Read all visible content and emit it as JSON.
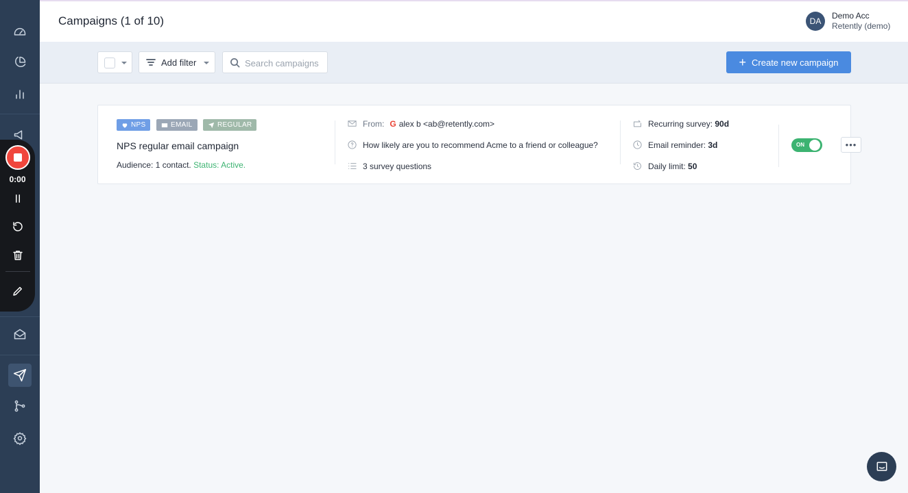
{
  "header": {
    "title": "Campaigns (1 of 10)",
    "user": {
      "initials": "DA",
      "name": "Demo Acc",
      "company": "Retently (demo)"
    }
  },
  "toolbar": {
    "add_filter_label": "Add filter",
    "search_placeholder": "Search campaigns",
    "create_label": "Create new campaign",
    "create_color": "#4a8ae0"
  },
  "recorder": {
    "time": "0:00",
    "stop_color": "#f0463c"
  },
  "sidebar": {
    "items": [
      {
        "icon": "dashboard-icon"
      },
      {
        "icon": "pie-chart-icon"
      },
      {
        "icon": "bar-chart-icon"
      },
      {
        "icon": "megaphone-icon"
      },
      {
        "icon": "inbox-icon"
      },
      {
        "icon": "send-icon",
        "active": true
      },
      {
        "icon": "git-branch-icon"
      },
      {
        "icon": "gear-icon"
      }
    ]
  },
  "campaign": {
    "tags": [
      "NPS",
      "EMAIL",
      "REGULAR"
    ],
    "name": "NPS regular email campaign",
    "audience": "Audience: 1 contact.",
    "status": "Status: Active.",
    "from_label": "From:",
    "from_value": "alex b <ab@retently.com>",
    "question": "How likely are you to recommend Acme to a friend or colleague?",
    "survey_questions": "3 survey questions",
    "recurring_label": "Recurring survey:",
    "recurring_value": "90d",
    "reminder_label": "Email reminder:",
    "reminder_value": "3d",
    "limit_label": "Daily limit:",
    "limit_value": "50",
    "toggle_label": "ON",
    "toggle_on": true,
    "status_color": "#3cb371"
  }
}
